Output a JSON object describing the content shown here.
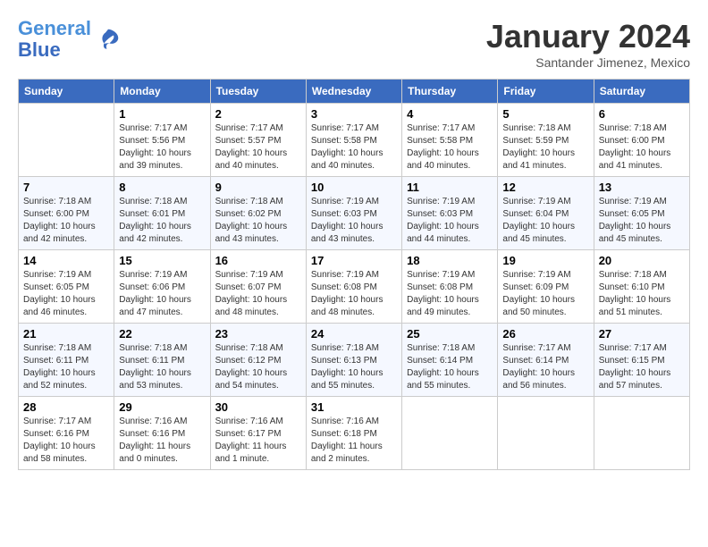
{
  "header": {
    "logo_line1": "General",
    "logo_line2": "Blue",
    "month": "January 2024",
    "location": "Santander Jimenez, Mexico"
  },
  "weekdays": [
    "Sunday",
    "Monday",
    "Tuesday",
    "Wednesday",
    "Thursday",
    "Friday",
    "Saturday"
  ],
  "weeks": [
    [
      {
        "day": "",
        "info": ""
      },
      {
        "day": "1",
        "info": "Sunrise: 7:17 AM\nSunset: 5:56 PM\nDaylight: 10 hours\nand 39 minutes."
      },
      {
        "day": "2",
        "info": "Sunrise: 7:17 AM\nSunset: 5:57 PM\nDaylight: 10 hours\nand 40 minutes."
      },
      {
        "day": "3",
        "info": "Sunrise: 7:17 AM\nSunset: 5:58 PM\nDaylight: 10 hours\nand 40 minutes."
      },
      {
        "day": "4",
        "info": "Sunrise: 7:17 AM\nSunset: 5:58 PM\nDaylight: 10 hours\nand 40 minutes."
      },
      {
        "day": "5",
        "info": "Sunrise: 7:18 AM\nSunset: 5:59 PM\nDaylight: 10 hours\nand 41 minutes."
      },
      {
        "day": "6",
        "info": "Sunrise: 7:18 AM\nSunset: 6:00 PM\nDaylight: 10 hours\nand 41 minutes."
      }
    ],
    [
      {
        "day": "7",
        "info": "Sunrise: 7:18 AM\nSunset: 6:00 PM\nDaylight: 10 hours\nand 42 minutes."
      },
      {
        "day": "8",
        "info": "Sunrise: 7:18 AM\nSunset: 6:01 PM\nDaylight: 10 hours\nand 42 minutes."
      },
      {
        "day": "9",
        "info": "Sunrise: 7:18 AM\nSunset: 6:02 PM\nDaylight: 10 hours\nand 43 minutes."
      },
      {
        "day": "10",
        "info": "Sunrise: 7:19 AM\nSunset: 6:03 PM\nDaylight: 10 hours\nand 43 minutes."
      },
      {
        "day": "11",
        "info": "Sunrise: 7:19 AM\nSunset: 6:03 PM\nDaylight: 10 hours\nand 44 minutes."
      },
      {
        "day": "12",
        "info": "Sunrise: 7:19 AM\nSunset: 6:04 PM\nDaylight: 10 hours\nand 45 minutes."
      },
      {
        "day": "13",
        "info": "Sunrise: 7:19 AM\nSunset: 6:05 PM\nDaylight: 10 hours\nand 45 minutes."
      }
    ],
    [
      {
        "day": "14",
        "info": "Sunrise: 7:19 AM\nSunset: 6:05 PM\nDaylight: 10 hours\nand 46 minutes."
      },
      {
        "day": "15",
        "info": "Sunrise: 7:19 AM\nSunset: 6:06 PM\nDaylight: 10 hours\nand 47 minutes."
      },
      {
        "day": "16",
        "info": "Sunrise: 7:19 AM\nSunset: 6:07 PM\nDaylight: 10 hours\nand 48 minutes."
      },
      {
        "day": "17",
        "info": "Sunrise: 7:19 AM\nSunset: 6:08 PM\nDaylight: 10 hours\nand 48 minutes."
      },
      {
        "day": "18",
        "info": "Sunrise: 7:19 AM\nSunset: 6:08 PM\nDaylight: 10 hours\nand 49 minutes."
      },
      {
        "day": "19",
        "info": "Sunrise: 7:19 AM\nSunset: 6:09 PM\nDaylight: 10 hours\nand 50 minutes."
      },
      {
        "day": "20",
        "info": "Sunrise: 7:18 AM\nSunset: 6:10 PM\nDaylight: 10 hours\nand 51 minutes."
      }
    ],
    [
      {
        "day": "21",
        "info": "Sunrise: 7:18 AM\nSunset: 6:11 PM\nDaylight: 10 hours\nand 52 minutes."
      },
      {
        "day": "22",
        "info": "Sunrise: 7:18 AM\nSunset: 6:11 PM\nDaylight: 10 hours\nand 53 minutes."
      },
      {
        "day": "23",
        "info": "Sunrise: 7:18 AM\nSunset: 6:12 PM\nDaylight: 10 hours\nand 54 minutes."
      },
      {
        "day": "24",
        "info": "Sunrise: 7:18 AM\nSunset: 6:13 PM\nDaylight: 10 hours\nand 55 minutes."
      },
      {
        "day": "25",
        "info": "Sunrise: 7:18 AM\nSunset: 6:14 PM\nDaylight: 10 hours\nand 55 minutes."
      },
      {
        "day": "26",
        "info": "Sunrise: 7:17 AM\nSunset: 6:14 PM\nDaylight: 10 hours\nand 56 minutes."
      },
      {
        "day": "27",
        "info": "Sunrise: 7:17 AM\nSunset: 6:15 PM\nDaylight: 10 hours\nand 57 minutes."
      }
    ],
    [
      {
        "day": "28",
        "info": "Sunrise: 7:17 AM\nSunset: 6:16 PM\nDaylight: 10 hours\nand 58 minutes."
      },
      {
        "day": "29",
        "info": "Sunrise: 7:16 AM\nSunset: 6:16 PM\nDaylight: 11 hours\nand 0 minutes."
      },
      {
        "day": "30",
        "info": "Sunrise: 7:16 AM\nSunset: 6:17 PM\nDaylight: 11 hours\nand 1 minute."
      },
      {
        "day": "31",
        "info": "Sunrise: 7:16 AM\nSunset: 6:18 PM\nDaylight: 11 hours\nand 2 minutes."
      },
      {
        "day": "",
        "info": ""
      },
      {
        "day": "",
        "info": ""
      },
      {
        "day": "",
        "info": ""
      }
    ]
  ]
}
